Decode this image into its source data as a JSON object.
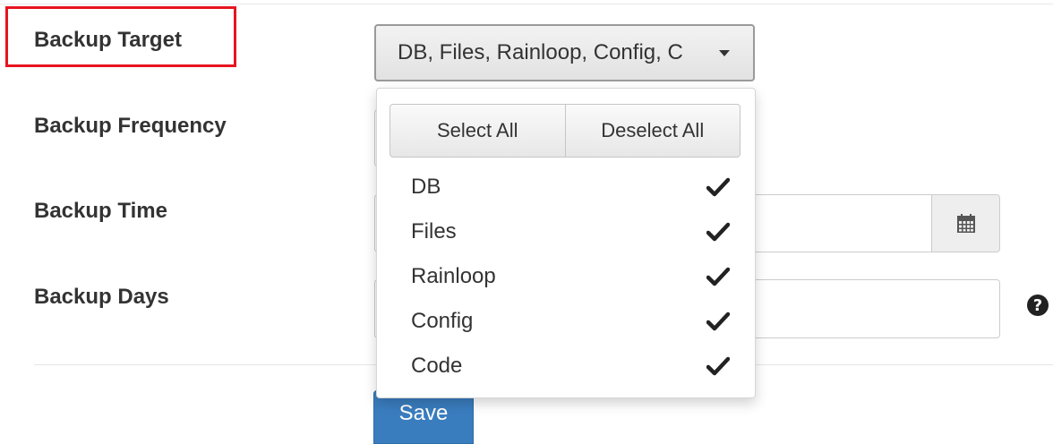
{
  "form": {
    "target_label": "Backup Target",
    "frequency_label": "Backup Frequency",
    "time_label": "Backup Time",
    "days_label": "Backup Days",
    "save_label": "Save"
  },
  "target_select": {
    "value": "DB, Files, Rainloop, Config, C"
  },
  "dropdown": {
    "select_all": "Select All",
    "deselect_all": "Deselect All",
    "options": [
      {
        "label": "DB",
        "checked": true
      },
      {
        "label": "Files",
        "checked": true
      },
      {
        "label": "Rainloop",
        "checked": true
      },
      {
        "label": "Config",
        "checked": true
      },
      {
        "label": "Code",
        "checked": true
      }
    ]
  },
  "icons": {
    "caret": "caret-down-icon",
    "calendar": "calendar-icon",
    "help": "question-circle-icon",
    "check": "check-icon"
  },
  "help_glyph": "?",
  "colors": {
    "highlight": "#e8141f",
    "primary": "#3a7dbf"
  }
}
